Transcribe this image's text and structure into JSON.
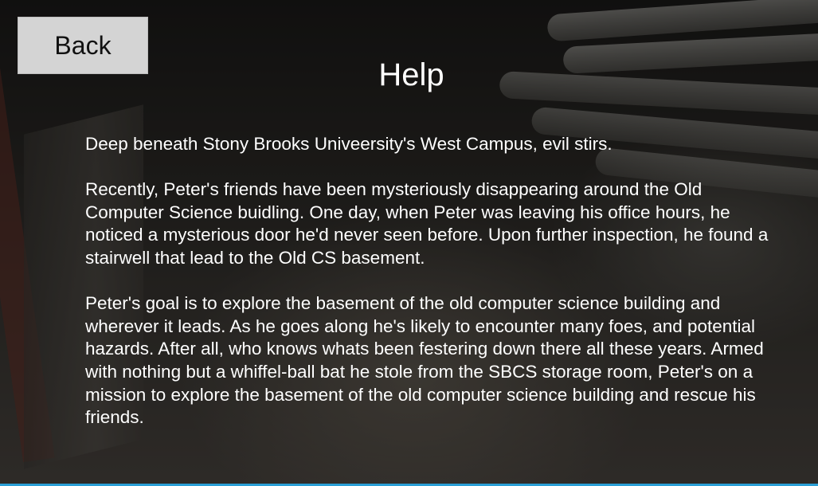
{
  "back_button": {
    "label": "Back"
  },
  "title": "Help",
  "paragraphs": [
    "Deep beneath Stony Brooks Univeersity's West Campus, evil stirs.",
    "Recently, Peter's friends have been mysteriously disappearing around the Old Computer Science buidling. One day, when Peter was leaving his office hours, he noticed a mysterious door he'd never seen before. Upon further inspection, he found a stairwell that lead to the Old CS basement.",
    "Peter's goal is to explore the basement of the old computer science building and wherever it leads. As he goes along he's likely to encounter many foes, and potential hazards. After all, who knows whats been festering down there all these years. Armed with nothing but a whiffel-ball bat he stole from the SBCS storage room, Peter's on a mission to explore the basement of the old computer science building and rescue his friends."
  ],
  "colors": {
    "button_bg": "#d4d4d4",
    "text": "#ffffff",
    "accent_line": "#2a9fd6"
  }
}
